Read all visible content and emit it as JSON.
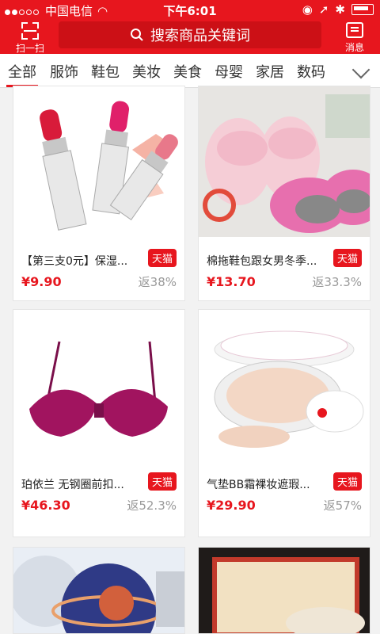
{
  "statusbar": {
    "carrier": "中国电信",
    "time": "下午6:01"
  },
  "header": {
    "scan_label": "扫一扫",
    "search_placeholder": "搜索商品关键词",
    "message_label": "消息"
  },
  "categories": [
    "全部",
    "服饰",
    "鞋包",
    "美妆",
    "美食",
    "母婴",
    "家居",
    "数码"
  ],
  "products": [
    {
      "title": "【第三支0元】保湿...",
      "tag": "天猫",
      "price": "¥9.90",
      "rebate": "返38%"
    },
    {
      "title": "棉拖鞋包跟女男冬季...",
      "tag": "天猫",
      "price": "¥13.70",
      "rebate": "返33.3%"
    },
    {
      "title": "珀依兰 无钢圈前扣...",
      "tag": "天猫",
      "price": "¥46.30",
      "rebate": "返52.3%"
    },
    {
      "title": "气垫BB霜裸妆遮瑕...",
      "tag": "天猫",
      "price": "¥29.90",
      "rebate": "返57%"
    }
  ]
}
